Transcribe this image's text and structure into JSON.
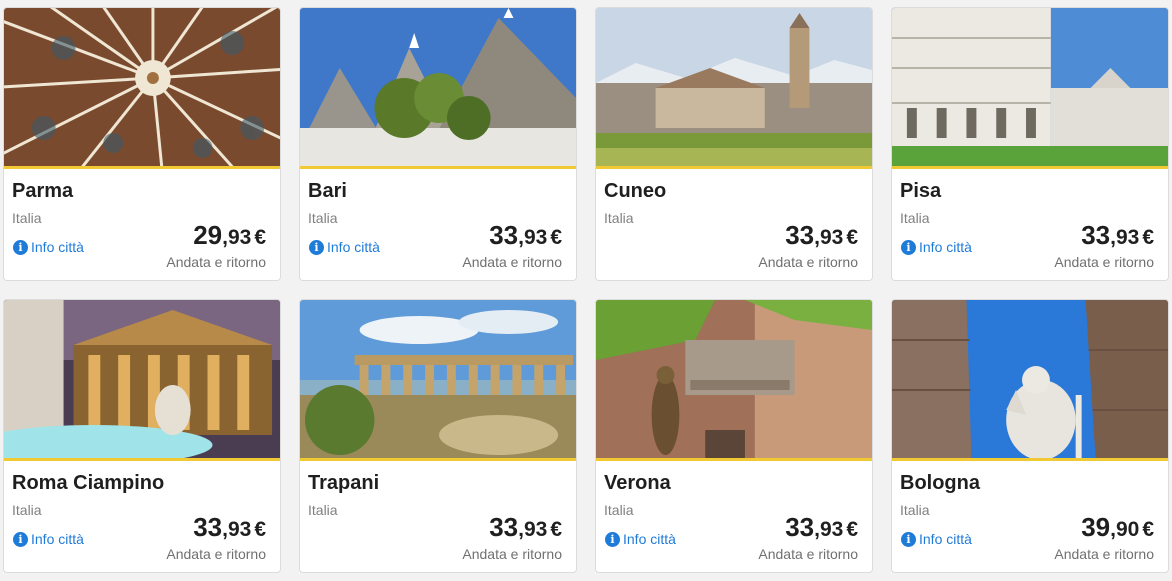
{
  "destinations": [
    {
      "city": "Parma",
      "country": "Italia",
      "info_label": "Info città",
      "price_int": "29",
      "price_dec": ",93",
      "currency": "€",
      "trip_type": "Andata e ritorno"
    },
    {
      "city": "Bari",
      "country": "Italia",
      "info_label": "Info città",
      "price_int": "33",
      "price_dec": ",93",
      "currency": "€",
      "trip_type": "Andata e ritorno"
    },
    {
      "city": "Cuneo",
      "country": "Italia",
      "info_label": "",
      "price_int": "33",
      "price_dec": ",93",
      "currency": "€",
      "trip_type": "Andata e ritorno"
    },
    {
      "city": "Pisa",
      "country": "Italia",
      "info_label": "Info città",
      "price_int": "33",
      "price_dec": ",93",
      "currency": "€",
      "trip_type": "Andata e ritorno"
    },
    {
      "city": "Roma Ciampino",
      "country": "Italia",
      "info_label": "Info città",
      "price_int": "33",
      "price_dec": ",93",
      "currency": "€",
      "trip_type": "Andata e ritorno"
    },
    {
      "city": "Trapani",
      "country": "Italia",
      "info_label": "",
      "price_int": "33",
      "price_dec": ",93",
      "currency": "€",
      "trip_type": "Andata e ritorno"
    },
    {
      "city": "Verona",
      "country": "Italia",
      "info_label": "Info città",
      "price_int": "33",
      "price_dec": ",93",
      "currency": "€",
      "trip_type": "Andata e ritorno"
    },
    {
      "city": "Bologna",
      "country": "Italia",
      "info_label": "Info città",
      "price_int": "39",
      "price_dec": ",90",
      "currency": "€",
      "trip_type": "Andata e ritorno"
    }
  ],
  "colors": {
    "accent": "#f1c933",
    "link": "#1f7bd8",
    "text": "#1f1f1f",
    "muted": "#808080"
  },
  "icons": {
    "info": "info-icon"
  }
}
